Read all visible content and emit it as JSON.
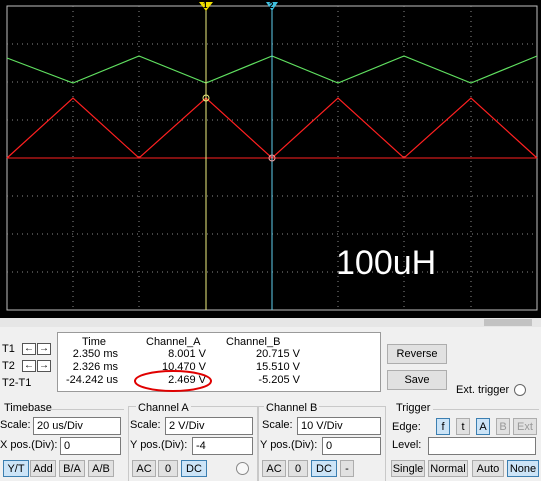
{
  "scope": {
    "annotation": "100uH",
    "marker_1": "2",
    "marker_2": "1"
  },
  "cursors": {
    "t1": "T1",
    "t2": "T2",
    "t2_t1": "T2-T1"
  },
  "readout": {
    "headers": [
      "Time",
      "Channel_A",
      "Channel_B"
    ],
    "rows": [
      [
        "2.350 ms",
        "8.001 V",
        "20.715 V"
      ],
      [
        "2.326 ms",
        "10.470 V",
        "15.510 V"
      ],
      [
        "-24.242 us",
        "2.469 V",
        "-5.205 V"
      ]
    ]
  },
  "buttons": {
    "reverse": "Reverse",
    "save": "Save",
    "ext_trigger": "Ext. trigger"
  },
  "timebase": {
    "title": "Timebase",
    "scale_label": "Scale:",
    "scale_value": "20 us/Div",
    "xpos_label": "X pos.(Div):",
    "xpos_value": "0",
    "modes": [
      "Y/T",
      "Add",
      "B/A",
      "A/B"
    ]
  },
  "channel_a": {
    "title": "Channel A",
    "scale_label": "Scale:",
    "scale_value": "2  V/Div",
    "ypos_label": "Y pos.(Div):",
    "ypos_value": "-4",
    "coupling": [
      "AC",
      "0",
      "DC"
    ]
  },
  "channel_b": {
    "title": "Channel B",
    "scale_label": "Scale:",
    "scale_value": "10  V/Div",
    "ypos_label": "Y pos.(Div):",
    "ypos_value": "0",
    "coupling": [
      "AC",
      "0",
      "DC",
      "-"
    ]
  },
  "trigger": {
    "title": "Trigger",
    "edge_label": "Edge:",
    "edge_buttons": [
      "f",
      "t",
      "A",
      "B",
      "Ext"
    ],
    "level_label": "Level:",
    "modes": [
      "Single",
      "Normal",
      "Auto",
      "None"
    ]
  },
  "colors": {
    "channel_a": "#ff2020",
    "channel_b": "#60e060",
    "cursor": "#f0f080",
    "highlight_circle": "#e00000"
  }
}
